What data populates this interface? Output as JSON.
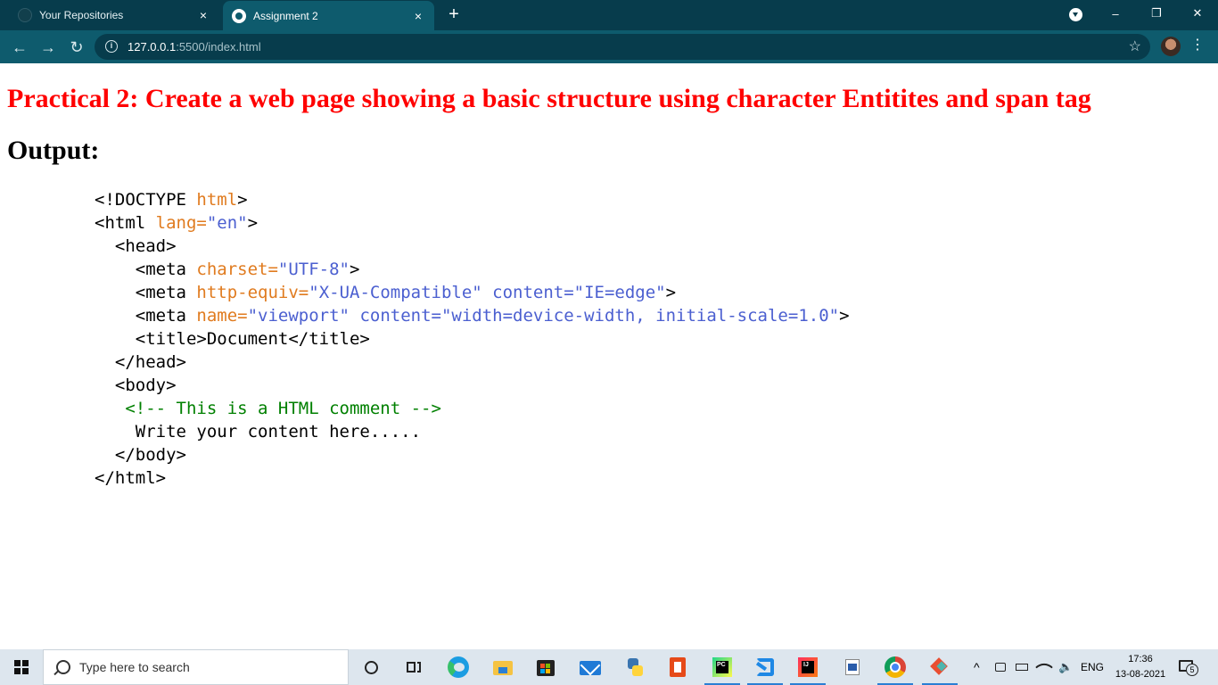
{
  "browser": {
    "tabs": [
      {
        "title": "Your Repositories",
        "active": false
      },
      {
        "title": "Assignment 2",
        "active": true
      }
    ],
    "close_glyph": "×",
    "new_tab_glyph": "+",
    "url_host": "127.0.0.1",
    "url_path": ":5500/index.html",
    "window_controls": {
      "minimize": "–",
      "maximize": "❐",
      "close": "✕"
    },
    "nav": {
      "back": "←",
      "forward": "→",
      "reload": "↻"
    },
    "star_glyph": "☆",
    "menu_glyph": "⋮"
  },
  "page": {
    "heading": "Practical 2: Create a web page showing a basic structure using character Entitites and span tag",
    "output_label": "Output:",
    "code_lines": [
      {
        "indent": "",
        "parts": [
          {
            "t": "<!DOCTYPE ",
            "c": "tag"
          },
          {
            "t": "html",
            "c": "attr"
          },
          {
            "t": ">",
            "c": "tag"
          }
        ]
      },
      {
        "indent": "",
        "parts": [
          {
            "t": "<html ",
            "c": "tag"
          },
          {
            "t": "lang=",
            "c": "attr"
          },
          {
            "t": "\"en\"",
            "c": "val"
          },
          {
            "t": ">",
            "c": "tag"
          }
        ]
      },
      {
        "indent": "  ",
        "parts": [
          {
            "t": "<head>",
            "c": "tag"
          }
        ]
      },
      {
        "indent": "    ",
        "parts": [
          {
            "t": "<meta ",
            "c": "tag"
          },
          {
            "t": "charset=",
            "c": "attr"
          },
          {
            "t": "\"UTF-8\"",
            "c": "val"
          },
          {
            "t": ">",
            "c": "tag"
          }
        ]
      },
      {
        "indent": "    ",
        "parts": [
          {
            "t": "<meta ",
            "c": "tag"
          },
          {
            "t": "http-equiv=",
            "c": "attr"
          },
          {
            "t": "\"X-UA-Compatible\" content=\"IE=edge\"",
            "c": "val"
          },
          {
            "t": ">",
            "c": "tag"
          }
        ]
      },
      {
        "indent": "    ",
        "parts": [
          {
            "t": "<meta ",
            "c": "tag"
          },
          {
            "t": "name=",
            "c": "attr"
          },
          {
            "t": "\"viewport\" content=\"width=device-width, initial-scale=1.0\"",
            "c": "val"
          },
          {
            "t": ">",
            "c": "tag"
          }
        ]
      },
      {
        "indent": "    ",
        "parts": [
          {
            "t": "<title>Document</title>",
            "c": "tag"
          }
        ]
      },
      {
        "indent": "  ",
        "parts": [
          {
            "t": "</head>",
            "c": "tag"
          }
        ]
      },
      {
        "indent": "  ",
        "parts": [
          {
            "t": "<body>",
            "c": "tag"
          }
        ]
      },
      {
        "indent": "   ",
        "parts": [
          {
            "t": "<!-- This is a HTML comment -->",
            "c": "comment"
          }
        ]
      },
      {
        "indent": "    ",
        "parts": [
          {
            "t": "Write your content here.....",
            "c": "tag"
          }
        ]
      },
      {
        "indent": "  ",
        "parts": [
          {
            "t": "</body>",
            "c": "tag"
          }
        ]
      },
      {
        "indent": "",
        "parts": [
          {
            "t": "</html>",
            "c": "tag"
          }
        ]
      }
    ],
    "colors": {
      "heading": "#ff0000",
      "attr": "#e07b1f",
      "val": "#4b5fd0",
      "comment": "#008000"
    }
  },
  "taskbar": {
    "search_placeholder": "Type here to search",
    "apps": [
      "cortana-icon",
      "task-view-icon",
      "edge-icon",
      "file-explorer-icon",
      "store-icon",
      "mail-icon",
      "python-icon",
      "office-icon",
      "pycharm-icon",
      "vscode-icon",
      "intellij-icon",
      "wordpad-icon",
      "chrome-icon",
      "git-icon"
    ],
    "tray": {
      "chevron": "^",
      "language": "ENG"
    },
    "time": "17:36",
    "date": "13-08-2021",
    "notification_count": "5"
  }
}
